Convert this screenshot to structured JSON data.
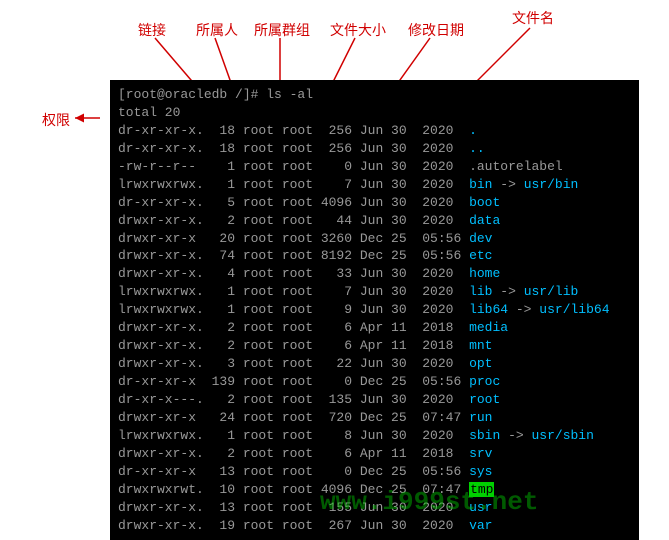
{
  "labels": {
    "permission": "权限",
    "links": "链接",
    "owner": "所属人",
    "group": "所属群组",
    "size": "文件大小",
    "date": "修改日期",
    "filename": "文件名"
  },
  "prompt": "[root@oracledb /]# ls -al",
  "total": "total 20",
  "rows": [
    {
      "perm": "dr-xr-xr-x.",
      "n": "18",
      "o": "root",
      "g": "root",
      "s": "256",
      "m": "Jun",
      "d": "30",
      "y": "2020",
      "name": ".",
      "cls": "cyan"
    },
    {
      "perm": "dr-xr-xr-x.",
      "n": "18",
      "o": "root",
      "g": "root",
      "s": "256",
      "m": "Jun",
      "d": "30",
      "y": "2020",
      "name": "..",
      "cls": "cyan"
    },
    {
      "perm": "-rw-r--r--",
      "n": "1",
      "o": "root",
      "g": "root",
      "s": "0",
      "m": "Jun",
      "d": "30",
      "y": "2020",
      "name": ".autorelabel",
      "cls": "gray"
    },
    {
      "perm": "lrwxrwxrwx.",
      "n": "1",
      "o": "root",
      "g": "root",
      "s": "7",
      "m": "Jun",
      "d": "30",
      "y": "2020",
      "name": "bin",
      "cls": "cyan",
      "link": "usr/bin"
    },
    {
      "perm": "dr-xr-xr-x.",
      "n": "5",
      "o": "root",
      "g": "root",
      "s": "4096",
      "m": "Jun",
      "d": "30",
      "y": "2020",
      "name": "boot",
      "cls": "cyan"
    },
    {
      "perm": "drwxr-xr-x.",
      "n": "2",
      "o": "root",
      "g": "root",
      "s": "44",
      "m": "Jun",
      "d": "30",
      "y": "2020",
      "name": "data",
      "cls": "cyan"
    },
    {
      "perm": "drwxr-xr-x",
      "n": "20",
      "o": "root",
      "g": "root",
      "s": "3260",
      "m": "Dec",
      "d": "25",
      "y": "05:56",
      "name": "dev",
      "cls": "cyan"
    },
    {
      "perm": "drwxr-xr-x.",
      "n": "74",
      "o": "root",
      "g": "root",
      "s": "8192",
      "m": "Dec",
      "d": "25",
      "y": "05:56",
      "name": "etc",
      "cls": "cyan"
    },
    {
      "perm": "drwxr-xr-x.",
      "n": "4",
      "o": "root",
      "g": "root",
      "s": "33",
      "m": "Jun",
      "d": "30",
      "y": "2020",
      "name": "home",
      "cls": "cyan"
    },
    {
      "perm": "lrwxrwxrwx.",
      "n": "1",
      "o": "root",
      "g": "root",
      "s": "7",
      "m": "Jun",
      "d": "30",
      "y": "2020",
      "name": "lib",
      "cls": "cyan",
      "link": "usr/lib"
    },
    {
      "perm": "lrwxrwxrwx.",
      "n": "1",
      "o": "root",
      "g": "root",
      "s": "9",
      "m": "Jun",
      "d": "30",
      "y": "2020",
      "name": "lib64",
      "cls": "cyan",
      "link": "usr/lib64"
    },
    {
      "perm": "drwxr-xr-x.",
      "n": "2",
      "o": "root",
      "g": "root",
      "s": "6",
      "m": "Apr",
      "d": "11",
      "y": "2018",
      "name": "media",
      "cls": "cyan"
    },
    {
      "perm": "drwxr-xr-x.",
      "n": "2",
      "o": "root",
      "g": "root",
      "s": "6",
      "m": "Apr",
      "d": "11",
      "y": "2018",
      "name": "mnt",
      "cls": "cyan"
    },
    {
      "perm": "drwxr-xr-x.",
      "n": "3",
      "o": "root",
      "g": "root",
      "s": "22",
      "m": "Jun",
      "d": "30",
      "y": "2020",
      "name": "opt",
      "cls": "cyan"
    },
    {
      "perm": "dr-xr-xr-x",
      "n": "139",
      "o": "root",
      "g": "root",
      "s": "0",
      "m": "Dec",
      "d": "25",
      "y": "05:56",
      "name": "proc",
      "cls": "cyan"
    },
    {
      "perm": "dr-xr-x---.",
      "n": "2",
      "o": "root",
      "g": "root",
      "s": "135",
      "m": "Jun",
      "d": "30",
      "y": "2020",
      "name": "root",
      "cls": "cyan"
    },
    {
      "perm": "drwxr-xr-x",
      "n": "24",
      "o": "root",
      "g": "root",
      "s": "720",
      "m": "Dec",
      "d": "25",
      "y": "07:47",
      "name": "run",
      "cls": "cyan"
    },
    {
      "perm": "lrwxrwxrwx.",
      "n": "1",
      "o": "root",
      "g": "root",
      "s": "8",
      "m": "Jun",
      "d": "30",
      "y": "2020",
      "name": "sbin",
      "cls": "cyan",
      "link": "usr/sbin"
    },
    {
      "perm": "drwxr-xr-x.",
      "n": "2",
      "o": "root",
      "g": "root",
      "s": "6",
      "m": "Apr",
      "d": "11",
      "y": "2018",
      "name": "srv",
      "cls": "cyan"
    },
    {
      "perm": "dr-xr-xr-x",
      "n": "13",
      "o": "root",
      "g": "root",
      "s": "0",
      "m": "Dec",
      "d": "25",
      "y": "05:56",
      "name": "sys",
      "cls": "cyan"
    },
    {
      "perm": "drwxrwxrwt.",
      "n": "10",
      "o": "root",
      "g": "root",
      "s": "4096",
      "m": "Dec",
      "d": "25",
      "y": "07:47",
      "name": "tmp",
      "cls": "green-hl"
    },
    {
      "perm": "drwxr-xr-x.",
      "n": "13",
      "o": "root",
      "g": "root",
      "s": "155",
      "m": "Jun",
      "d": "30",
      "y": "2020",
      "name": "usr",
      "cls": "cyan"
    },
    {
      "perm": "drwxr-xr-x.",
      "n": "19",
      "o": "root",
      "g": "root",
      "s": "267",
      "m": "Jun",
      "d": "30",
      "y": "2020",
      "name": "var",
      "cls": "cyan"
    }
  ],
  "watermark": "www.i999st.net"
}
